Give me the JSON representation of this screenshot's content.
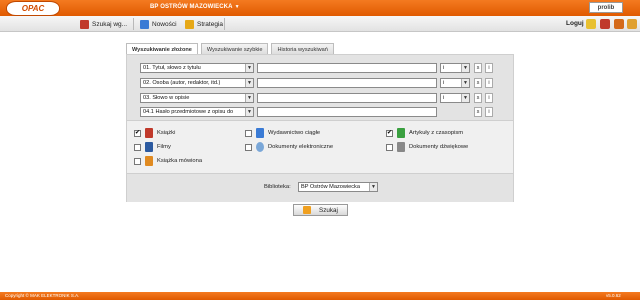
{
  "header": {
    "logo_text": "OPAC",
    "library_name": "BP OSTRÓW MAZOWIECKA",
    "brand": "prolib"
  },
  "toolbar": {
    "search_label": "Szukaj wg...",
    "news_label": "Nowości",
    "strategy_label": "Strategia",
    "login_label": "Loguj"
  },
  "tabs": [
    {
      "label": "Wyszukiwanie złożone"
    },
    {
      "label": "Wyszukiwanie szybkie"
    },
    {
      "label": "Historia wyszukiwań"
    }
  ],
  "criteria": [
    {
      "field": "01. Tytuł, słowo z tytułu",
      "operator": "i",
      "s": "s",
      "info": "i"
    },
    {
      "field": "02. Osoba (autor, redaktor, itd.)",
      "operator": "i",
      "s": "s",
      "info": "i"
    },
    {
      "field": "03. Słowo w opisie",
      "operator": "i",
      "s": "s",
      "info": "i"
    },
    {
      "field": "04.1 Hasło przedmiotowe z opisu do",
      "s": "s",
      "info": "i"
    }
  ],
  "material_types": [
    {
      "label": "Książki",
      "checked": true,
      "icon": "book-icon"
    },
    {
      "label": "Wydawnictwo ciągłe",
      "checked": false,
      "icon": "periodical-icon"
    },
    {
      "label": "Artykuły z czasopism",
      "checked": true,
      "icon": "article-icon"
    },
    {
      "label": "Filmy",
      "checked": false,
      "icon": "film-icon"
    },
    {
      "label": "Dokumenty elektroniczne",
      "checked": false,
      "icon": "cd-icon"
    },
    {
      "label": "Dokumenty dźwiękowe",
      "checked": false,
      "icon": "speaker-icon"
    },
    {
      "label": "Książka mówiona",
      "checked": false,
      "icon": "audiobook-icon"
    }
  ],
  "library_filter": {
    "label": "Biblioteka:",
    "selected": "BP Ostrów Mazowiecka"
  },
  "search_button": "Szukaj",
  "footer": {
    "copyright": "Copyright © MAK ELEKTRONIK S.A.",
    "version": "v5.0.62"
  }
}
